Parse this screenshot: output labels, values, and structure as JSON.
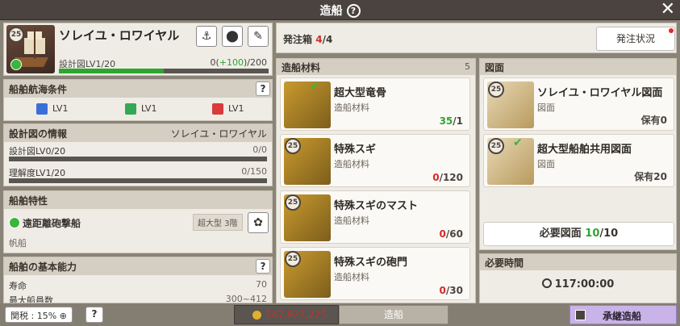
{
  "window": {
    "title": "造船",
    "help": "?",
    "close": "✕"
  },
  "ship": {
    "level_badge": "25",
    "name": "ソレイユ・ロワイヤル",
    "blueprint_label": "設計図LV1/20",
    "blueprint_progress_text_start": "0(",
    "blueprint_progress_bonus": "+100",
    "blueprint_progress_text_end": ")/200",
    "progress_fraction": 0.5
  },
  "navigation_conditions": {
    "title": "船舶航海条件",
    "help": "?",
    "items": [
      {
        "icon": "sail-icon",
        "label": "LV1",
        "color": "#3a6fd8"
      },
      {
        "icon": "rudder-icon",
        "label": "LV1",
        "color": "#34a853"
      },
      {
        "icon": "cross-icon",
        "label": "LV1",
        "color": "#d93a3a"
      }
    ]
  },
  "blueprint_info": {
    "title": "設計図の情報",
    "ship_name": "ソレイユ・ロワイヤル",
    "rows": [
      {
        "label": "設計図LV0/20",
        "value": "0/0"
      },
      {
        "label": "理解度LV1/20",
        "value": "0/150"
      }
    ]
  },
  "ship_traits": {
    "title": "船舶特性",
    "type_name": "遠距離砲撃船",
    "size_tag": "超大型 3階",
    "category": "帆船"
  },
  "basic_stats": {
    "title": "船舶の基本能力",
    "help": "?",
    "rows": [
      {
        "label": "寿命",
        "value": "70"
      },
      {
        "label": "最大船員数",
        "value": "300~412"
      }
    ]
  },
  "order_box": {
    "label": "発注箱",
    "current": "4",
    "max": "/4",
    "status_button": "発注状況"
  },
  "materials": {
    "title": "造船材料",
    "count": "5",
    "items": [
      {
        "name": "超大型竜骨",
        "sub": "造船材料",
        "have": "35",
        "need": "/1",
        "enough": true,
        "badge": "",
        "checked": true
      },
      {
        "name": "特殊スギ",
        "sub": "造船材料",
        "have": "0",
        "need": "/120",
        "enough": false,
        "badge": "25",
        "checked": false
      },
      {
        "name": "特殊スギのマスト",
        "sub": "造船材料",
        "have": "0",
        "need": "/60",
        "enough": false,
        "badge": "25",
        "checked": false
      },
      {
        "name": "特殊スギの砲門",
        "sub": "造船材料",
        "have": "0",
        "need": "/30",
        "enough": false,
        "badge": "25",
        "checked": false
      }
    ]
  },
  "blueprints": {
    "title": "図面",
    "items": [
      {
        "name": "ソレイユ・ロワイヤル図面",
        "sub": "図面",
        "owned": "保有0",
        "badge": "25",
        "checked": false
      },
      {
        "name": "超大型船舶共用図面",
        "sub": "図面",
        "owned": "保有20",
        "badge": "25",
        "checked": true
      }
    ],
    "required_label": "必要図面",
    "required_have": "10",
    "required_total": "/10"
  },
  "time": {
    "title": "必要時間",
    "value": "117:00:00"
  },
  "footer": {
    "tax_label": "関税 : 15%",
    "help": "?",
    "silver": "747,927,225",
    "build_label": "造船",
    "inherit_label": "承継造船"
  }
}
